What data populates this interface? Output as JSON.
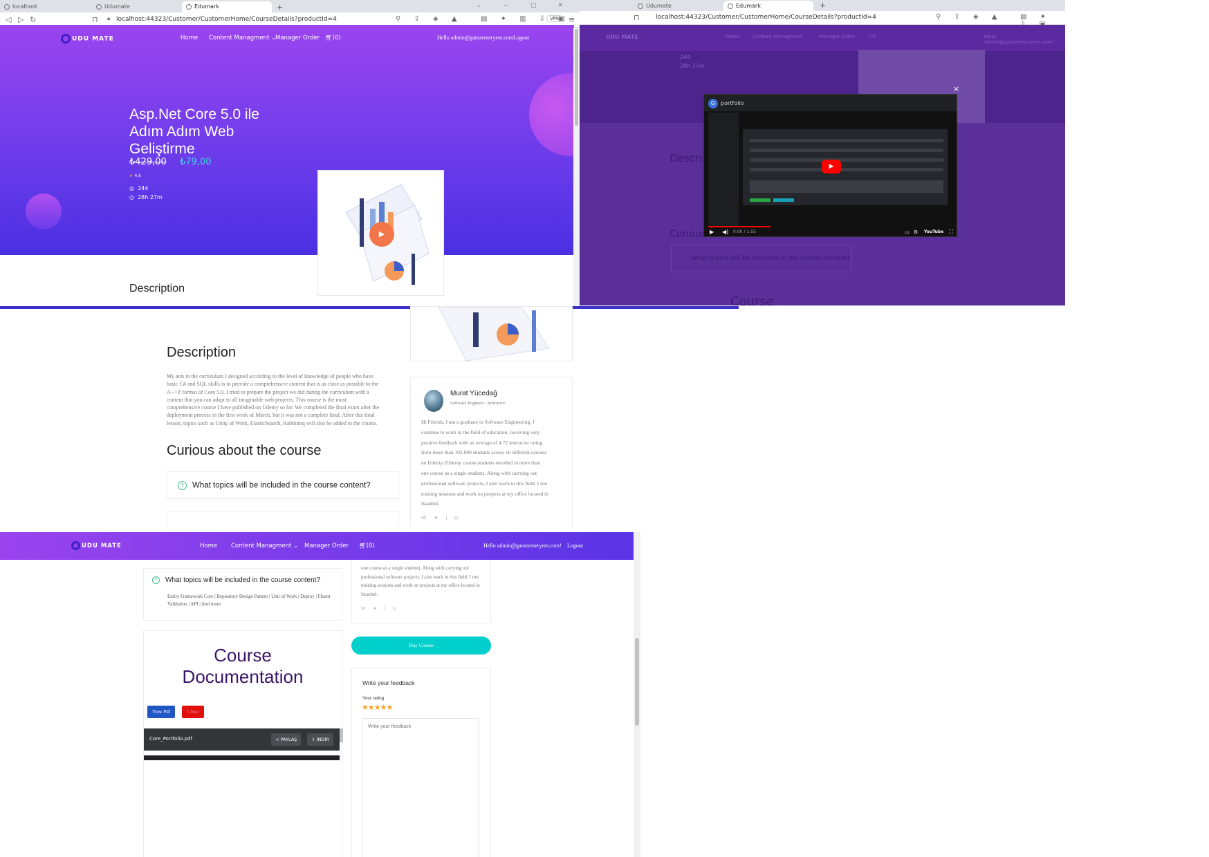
{
  "browser": {
    "tabs": [
      "localhost",
      "Udumate",
      "Edumark"
    ],
    "new_tab": "+",
    "url": "localhost:44323/Customer/CustomerHome/CourseDetails?productId=4",
    "vpn": "VPN"
  },
  "site": {
    "logo": "UDU MATE",
    "nav": [
      "Home",
      "Content Managment",
      "Manager Order"
    ],
    "cart": "(0)",
    "greeting": "Hello admin@gamzemeryem.com!",
    "logout": "Logout"
  },
  "course": {
    "title_line1": "Asp.Net Core 5.0 ile",
    "title_line2": "Adım Adım Web",
    "title_line3": "Geliştirme",
    "old_price": "₺429,00",
    "new_price": "₺79,00",
    "rating": "4,6",
    "lessons": "244",
    "duration": "28h 27m"
  },
  "description": {
    "heading": "Description",
    "lines": [
      "My aim in the curriculum I designed according to the level of knowledge of people who have",
      "basic C# and SQL skills is to provide a comprehensive content that is as close as possible to the",
      "A-->Z format of Core 5.0. I tried to prepare the project we did during the curriculum with a",
      "content that you can adapt to all imaginable web projects. This course is the most",
      "comprehensive course I have published on Udemy so far. We completed the final exam after the",
      "deployment process in the first week of March, but it was not a complete final. After this final",
      "lesson, topics such as Unity of Work, ElasticSearch, Rabbitmq will also be added to the course."
    ]
  },
  "faq": {
    "heading": "Curious about the course",
    "question": "What topics will be included in the course content?",
    "answer_line1": "Entity Framework Core | Repository Design Pattern | Unit of Work | Deploy | Fluent",
    "answer_line2": "Validation | API | And more"
  },
  "instructor": {
    "name": "Murat Yücedağ",
    "role": "Software Engineer - Instructor",
    "bio": [
      "Hi Friends, I am a graduate in Software Engineering. I",
      "continue to work in the field of education, receiving very",
      "positive feedback with an average of 4.72 instructor rating",
      "from more than 102,000 students across 16 different courses",
      "on Udemy (Udemy counts students enrolled in more than",
      "one course as a single student). Along with carrying out",
      "professional software projects, I also teach in this field. I run",
      "training sessions and work on projects at my office located in",
      "Istanbul."
    ]
  },
  "documentation": {
    "title_line1": "Course",
    "title_line2": "Documentation",
    "view_pdf": "View Pdf",
    "close": "Close",
    "file_name": "Core_Portfolio.pdf",
    "share": "PAYLAŞ",
    "download": "İNDİR"
  },
  "purchase": {
    "buy": "Buy Course"
  },
  "feedback": {
    "heading": "Write your feedback",
    "rating_label": "Your rating",
    "placeholder": "Write your feedback"
  },
  "video": {
    "channel_initial": "G",
    "channel_title": "portfolio",
    "time": "0:00 / 1:55",
    "brand": "YouTube",
    "close": "×"
  },
  "colors": {
    "accent": "#7a3ee8",
    "teal": "#00cfcb",
    "price_teal": "#3dd6e3",
    "orange": "#f27649"
  }
}
